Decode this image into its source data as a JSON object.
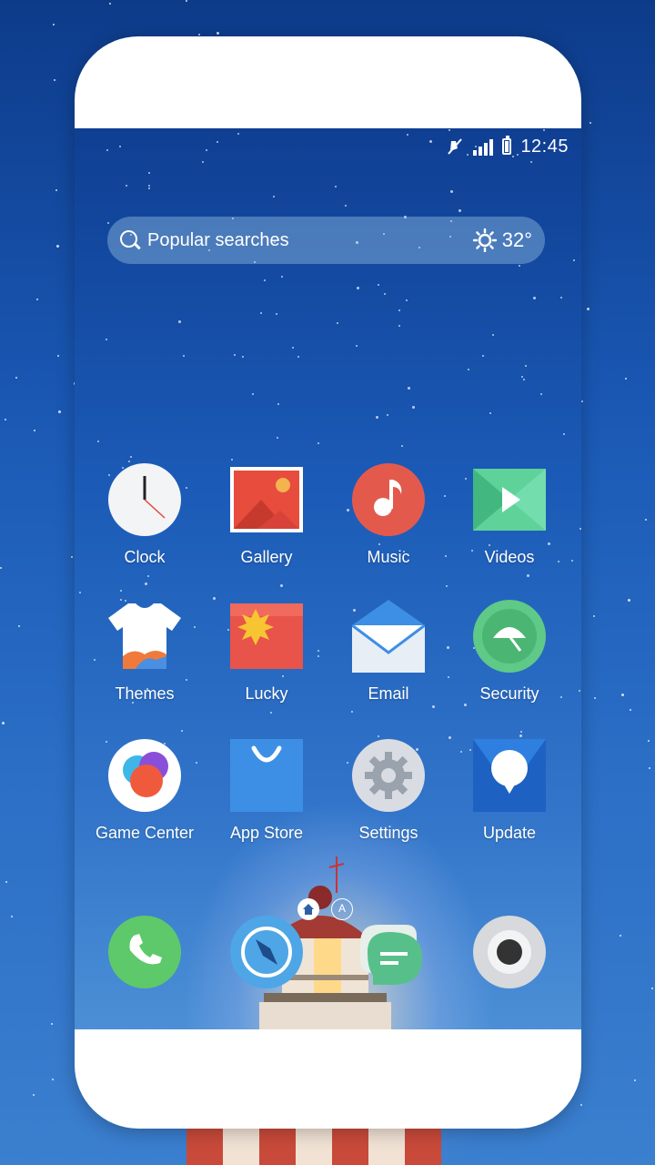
{
  "status_bar": {
    "time": "12:45"
  },
  "search": {
    "placeholder": "Popular searches",
    "temperature": "32°"
  },
  "apps": [
    {
      "label": "Clock",
      "icon": "clock-icon"
    },
    {
      "label": "Gallery",
      "icon": "gallery-icon"
    },
    {
      "label": "Music",
      "icon": "music-icon"
    },
    {
      "label": "Videos",
      "icon": "videos-icon"
    },
    {
      "label": "Themes",
      "icon": "themes-icon"
    },
    {
      "label": "Lucky",
      "icon": "lucky-icon"
    },
    {
      "label": "Email",
      "icon": "email-icon"
    },
    {
      "label": "Security",
      "icon": "security-icon"
    },
    {
      "label": "Game Center",
      "icon": "game-center-icon"
    },
    {
      "label": "App Store",
      "icon": "app-store-icon"
    },
    {
      "label": "Settings",
      "icon": "settings-icon"
    },
    {
      "label": "Update",
      "icon": "update-icon"
    }
  ],
  "pager": {
    "alt_page_label": "A"
  },
  "dock": [
    {
      "icon": "phone-icon"
    },
    {
      "icon": "browser-icon"
    },
    {
      "icon": "messages-icon"
    },
    {
      "icon": "camera-icon"
    }
  ],
  "colors": {
    "clock": "#f4f4f4",
    "gallery": "#e84c3d",
    "music": "#e35a4d",
    "videos": "#4fc98e",
    "security": "#5fc987",
    "app_store": "#3d8fe6",
    "update": "#2f7fe0",
    "phone": "#5ec96a",
    "browser": "#4ea6e6",
    "messages": "#57c08a"
  }
}
